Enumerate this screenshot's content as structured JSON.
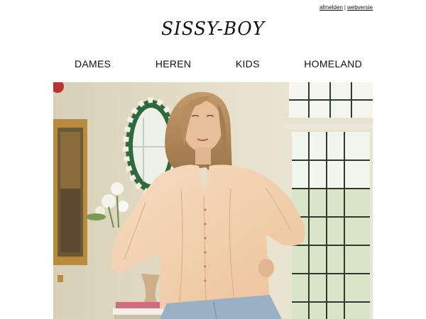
{
  "header": {
    "links": [
      {
        "label": "afmelden"
      },
      {
        "label": "webversie"
      }
    ],
    "separator": "|",
    "logo_text": "SISSY-BOY"
  },
  "nav": {
    "items": [
      {
        "label": "DAMES"
      },
      {
        "label": "HEREN"
      },
      {
        "label": "KIDS"
      },
      {
        "label": "HOMELAND"
      }
    ]
  },
  "hero": {
    "image": "woman-in-peach-blouse-photo",
    "colors": {
      "wall": "#e3dcc6",
      "blouse": "#f2cda8",
      "window": "#f4f7ef",
      "frame": "#b98b3e"
    }
  }
}
